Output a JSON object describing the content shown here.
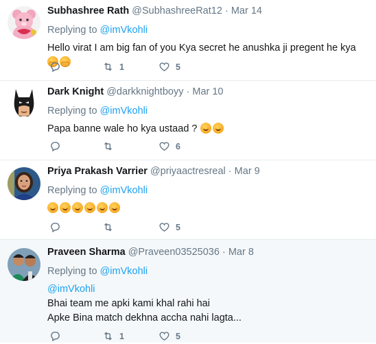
{
  "tweets": [
    {
      "name": "Subhashree Rath",
      "handle": "@SubhashreeRat12",
      "separator": "·",
      "date": "Mar 14",
      "replying_label": "Replying to",
      "replying_to": "@imVkohli",
      "text": "Hello virat I am big fan of you Kya secret he anushka ji pregent he kya",
      "retweets": "1",
      "likes": "5",
      "avatar": "pink-teddy-bear"
    },
    {
      "name": "Dark Knight",
      "handle": "@darkknightboyy",
      "separator": "·",
      "date": "Mar 10",
      "replying_label": "Replying to",
      "replying_to": "@imVkohli",
      "text": "Papa banne wale ho kya ustaad ?",
      "retweets": "",
      "likes": "6",
      "avatar": "batman-mask"
    },
    {
      "name": "Priya Prakash Varrier",
      "handle": "@priyaactresreal",
      "separator": "·",
      "date": "Mar 9",
      "replying_label": "Replying to",
      "replying_to": "@imVkohli",
      "text": "",
      "retweets": "",
      "likes": "5",
      "avatar": "woman-portrait"
    },
    {
      "name": "Praveen Sharma",
      "handle": "@Praveen03525036",
      "separator": "·",
      "date": "Mar 8",
      "replying_label": "Replying to",
      "replying_to": "@imVkohli",
      "mention_line": "@imVkohli",
      "text_line1": "Bhai team me apki kami khal rahi hai",
      "text_line2": "Apke Bina match dekhna accha nahi lagta...",
      "retweets": "1",
      "likes": "5",
      "avatar": "two-men-portrait"
    }
  ],
  "icons": {
    "reply": "reply-icon",
    "retweet": "retweet-icon",
    "like": "heart-icon"
  },
  "colors": {
    "link": "#1da1f2",
    "muted": "#657786",
    "text": "#14171a",
    "shaded_bg": "#f5f8fa",
    "divider": "#e6ecf0"
  }
}
